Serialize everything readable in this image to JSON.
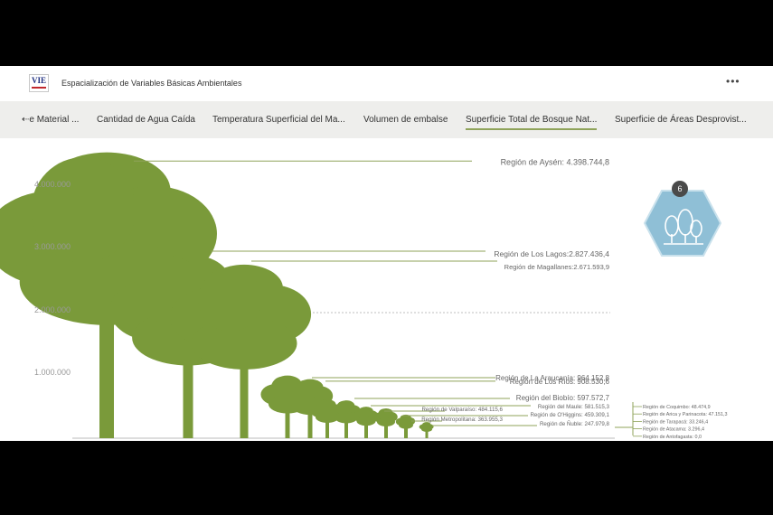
{
  "header": {
    "logo_text": "VIE",
    "title": "Espacialización de Variables Básicas Ambientales",
    "more_label": "•••"
  },
  "tabs": [
    {
      "label": "⇠e Material ..."
    },
    {
      "label": "Cantidad de Agua Caída"
    },
    {
      "label": "Temperatura Superficial del Ma..."
    },
    {
      "label": "Volumen de embalse"
    },
    {
      "label": "Superficie Total de Bosque Nat..."
    },
    {
      "label": "Superficie de Áreas Desprovist..."
    }
  ],
  "badge": {
    "number": "6",
    "icon": "forest-icon",
    "color": "#8fbfd6"
  },
  "colors": {
    "tree": "#7a9a3a",
    "leader": "#8fa35a",
    "label": "#666666"
  },
  "chart_data": {
    "type": "bar",
    "ylim": [
      0,
      4500000
    ],
    "yticks": [
      "4.000.000",
      "3.000.000",
      "2.000.000",
      "1.000.000"
    ],
    "ytick_values": [
      4000000,
      3000000,
      2000000,
      1000000
    ],
    "categories": [
      "Región de Aysén",
      "Región de Los Lagos",
      "Región de Magallanes",
      "Región de La Araucanía",
      "Región de Los Ríos",
      "Región del  Biobío",
      "Región del  Maule",
      "Región de Valparaíso",
      "Región de O'Higgins",
      "Región Metropolitana",
      "Región de Ñuble",
      "Región de Coquimbo",
      "Región de Arica y Parinacota",
      "Región de Tarapacá",
      "Región de Atacama",
      "Región de Antofagasta"
    ],
    "values": [
      4398744.8,
      2827436.4,
      2671593.9,
      964152.8,
      908530.6,
      597572.7,
      581515.3,
      484115.6,
      459309.1,
      363955.3,
      247979.8,
      48474.9,
      47151.3,
      33246.4,
      3296.4,
      0.0
    ],
    "value_labels": [
      "Región de Aysén: 4.398.744,8",
      "Región de Los Lagos:2.827.436,4",
      "Región de Magallanes:2.671.593,9",
      "Región de La Araucanía: 964.152,8",
      "Región de Los Ríos: 908.530,6",
      "Región del  Biobío: 597.572,7",
      "Región del  Maule: 581.515,3",
      "Región de Valparaíso: 484.115,6",
      "Región de O'Higgins: 459.309,1",
      "Región Metropolitana: 363.955,3",
      "Región de Ñuble: 247.979,8",
      "Región de Coquimbo: 48.474,9",
      "Región de Arica y Parinacota: 47.151,3",
      "Región de Tarapacá: 33.246,4",
      "Región de Atacama: 3.296,4",
      "Región de Antofagasta: 0,0"
    ]
  }
}
